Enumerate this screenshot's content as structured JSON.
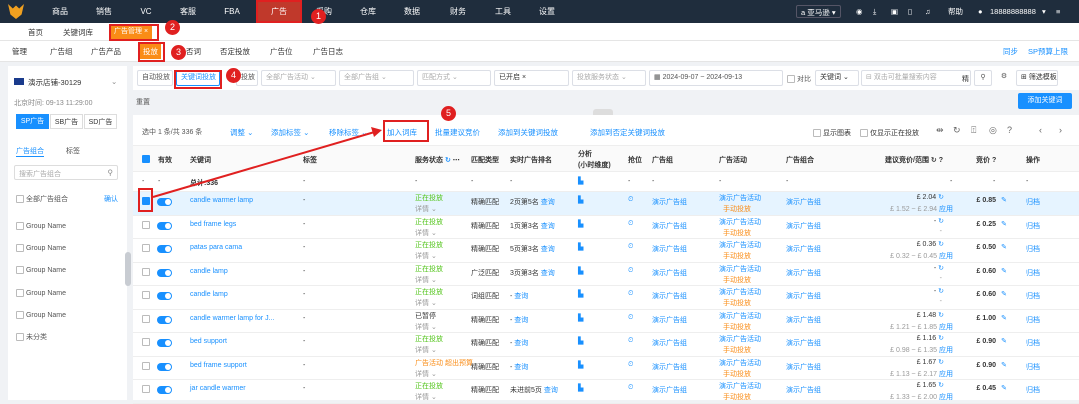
{
  "topnav": {
    "items": [
      "商品",
      "销售",
      "VC",
      "客服",
      "FBA",
      "广告",
      "采购",
      "仓库",
      "数据",
      "财务",
      "工具",
      "设置"
    ],
    "active": "广告",
    "store": "亚马逊",
    "help": "帮助",
    "phone": "18888888888"
  },
  "tabs": {
    "home": "首页",
    "t1": "关键词库",
    "t2": "广告管理"
  },
  "subnav": {
    "items": [
      "管理",
      "广告组",
      "广告产品",
      "投放",
      "否词",
      "否定投放",
      "广告位",
      "广告日志"
    ],
    "right1": "同步",
    "right2": "SP预算上限"
  },
  "left": {
    "shop": "演示店铺-30129",
    "time": "北京时间: 09-13 11:29:00",
    "types": [
      "SP广告",
      "SB广告",
      "SD广告"
    ],
    "tab1": "广告组合",
    "tab2": "标签",
    "search_placeholder": "搜索广告组合",
    "all": "全部广告组合",
    "confirm": "确认",
    "groups": [
      "Group Name",
      "Group Name",
      "Group Name",
      "Group Name",
      "Group Name",
      "未分类"
    ]
  },
  "filters": {
    "f1": "自动投放",
    "f2": "关键词投放",
    "f3": "投放",
    "f4": "全部广告活动",
    "f5": "全部广告组",
    "f6": "匹配方式",
    "f7": "已开启",
    "f8": "投放服务状态",
    "date_from": "2024-09-07",
    "date_sep": "~",
    "date_to": "2024-09-13",
    "compare": "对比",
    "kw": "关键词",
    "search_placeholder": "双击可批量搜索内容",
    "exact": "精",
    "filter_tpl": "筛选模板",
    "reset": "重置",
    "add_kw": "添加关键词"
  },
  "toolbar": {
    "selected": "选中 1 条/共 336 条",
    "adjust": "调整",
    "add_tag": "添加标签",
    "remove_tag": "移除标签",
    "add_lib": "加入词库",
    "batch_bid": "批量建议竞价",
    "add_to_kw": "添加到关键词投放",
    "add_to_neg": "添加到否定关键词投放",
    "show_chart": "显示图表",
    "only_active": "仅显示正在投放"
  },
  "headers": {
    "valid": "有效",
    "kw": "关键词",
    "tag": "标签",
    "status": "服务状态",
    "match": "匹配类型",
    "rank": "实时广告排名",
    "analysis": "分析",
    "analysis2": "(小时维度)",
    "bid_pos": "抢位",
    "group": "广告组",
    "campaign": "广告活动",
    "portfolio": "广告组合",
    "suggest": "建议竞价/范围",
    "bid": "竞价",
    "op": "操作"
  },
  "total": {
    "label": "总计:336",
    "dash": "-"
  },
  "rows": [
    {
      "kw": "candle warmer lamp",
      "tag": "-",
      "status": "正在投放",
      "detail": "详情",
      "match": "精确匹配",
      "rank": "2页第5名",
      "query": "查询",
      "group": "演示广告组",
      "campaign": "演示广告活动",
      "mode": "手动投放",
      "portfolio": "演示广告组",
      "bid1": "£ 2.04",
      "bid2": "£ 1.52 ~ £ 2.94",
      "apply": "应用",
      "bid": "£ 0.85",
      "op": "归档",
      "checked": true
    },
    {
      "kw": "bed frame legs",
      "tag": "-",
      "status": "正在投放",
      "detail": "详情",
      "match": "精确匹配",
      "rank": "1页第3名",
      "query": "查询",
      "group": "演示广告组",
      "campaign": "演示广告活动",
      "mode": "手动投放",
      "portfolio": "演示广告组",
      "bid1": "-",
      "bid2": "-",
      "apply": "",
      "bid": "£ 0.25",
      "op": "归档",
      "checked": false
    },
    {
      "kw": "patas para cama",
      "tag": "-",
      "status": "正在投放",
      "detail": "详情",
      "match": "精确匹配",
      "rank": "5页第3名",
      "query": "查询",
      "group": "演示广告组",
      "campaign": "演示广告活动",
      "mode": "手动投放",
      "portfolio": "演示广告组",
      "bid1": "£ 0.36",
      "bid2": "£ 0.32 ~ £ 0.45",
      "apply": "应用",
      "bid": "£ 0.50",
      "op": "归档",
      "checked": false
    },
    {
      "kw": "candle lamp",
      "tag": "-",
      "status": "正在投放",
      "detail": "详情",
      "match": "广泛匹配",
      "rank": "3页第3名",
      "query": "查询",
      "group": "演示广告组",
      "campaign": "演示广告活动",
      "mode": "手动投放",
      "portfolio": "演示广告组",
      "bid1": "-",
      "bid2": "-",
      "apply": "",
      "bid": "£ 0.60",
      "op": "归档",
      "checked": false
    },
    {
      "kw": "candle lamp",
      "tag": "-",
      "status": "正在投放",
      "detail": "详情",
      "match": "词组匹配",
      "rank": "- ",
      "query": "查询",
      "group": "演示广告组",
      "campaign": "演示广告活动",
      "mode": "手动投放",
      "portfolio": "演示广告组",
      "bid1": "-",
      "bid2": "-",
      "apply": "",
      "bid": "£ 0.60",
      "op": "归档",
      "checked": false
    },
    {
      "kw": "candle warmer lamp for J...",
      "tag": "-",
      "status": "已暂停",
      "detail": "详情",
      "match": "精确匹配",
      "rank": "- ",
      "query": "查询",
      "group": "演示广告组",
      "campaign": "演示广告活动",
      "mode": "手动投放",
      "portfolio": "演示广告组",
      "bid1": "£ 1.48",
      "bid2": "£ 1.21 ~ £ 1.85",
      "apply": "应用",
      "bid": "£ 1.00",
      "op": "归档",
      "checked": false
    },
    {
      "kw": "bed support",
      "tag": "-",
      "status": "正在投放",
      "detail": "详情",
      "match": "精确匹配",
      "rank": "- ",
      "query": "查询",
      "group": "演示广告组",
      "campaign": "演示广告活动",
      "mode": "手动投放",
      "portfolio": "演示广告组",
      "bid1": "£ 1.16",
      "bid2": "£ 0.98 ~ £ 1.35",
      "apply": "应用",
      "bid": "£ 0.90",
      "op": "归档",
      "checked": false
    },
    {
      "kw": "bed frame support",
      "tag": "-",
      "status": "广告活动 超出预算",
      "detail": "详情",
      "match": "精确匹配",
      "rank": "- ",
      "query": "查询",
      "group": "演示广告组",
      "campaign": "演示广告活动",
      "mode": "手动投放",
      "portfolio": "演示广告组",
      "bid1": "£ 1.67",
      "bid2": "£ 1.13 ~ £ 2.17",
      "apply": "应用",
      "bid": "£ 0.90",
      "op": "归档",
      "checked": false
    },
    {
      "kw": "jar candle warmer",
      "tag": "-",
      "status": "正在投放",
      "detail": "详情",
      "match": "精确匹配",
      "rank": "未进前5页",
      "query": "查询",
      "group": "演示广告组",
      "campaign": "演示广告活动",
      "mode": "手动投放",
      "portfolio": "演示广告组",
      "bid1": "£ 1.65",
      "bid2": "£ 1.33 ~ £ 2.00",
      "apply": "应用",
      "bid": "£ 0.45",
      "op": "归档",
      "checked": false
    }
  ],
  "badges": [
    "1",
    "2",
    "3",
    "4",
    "5"
  ],
  "colors": {
    "accent": "#1890ff",
    "nav": "#1f2d3d",
    "annotation": "#e02020",
    "active_nav": "#c0392b"
  }
}
